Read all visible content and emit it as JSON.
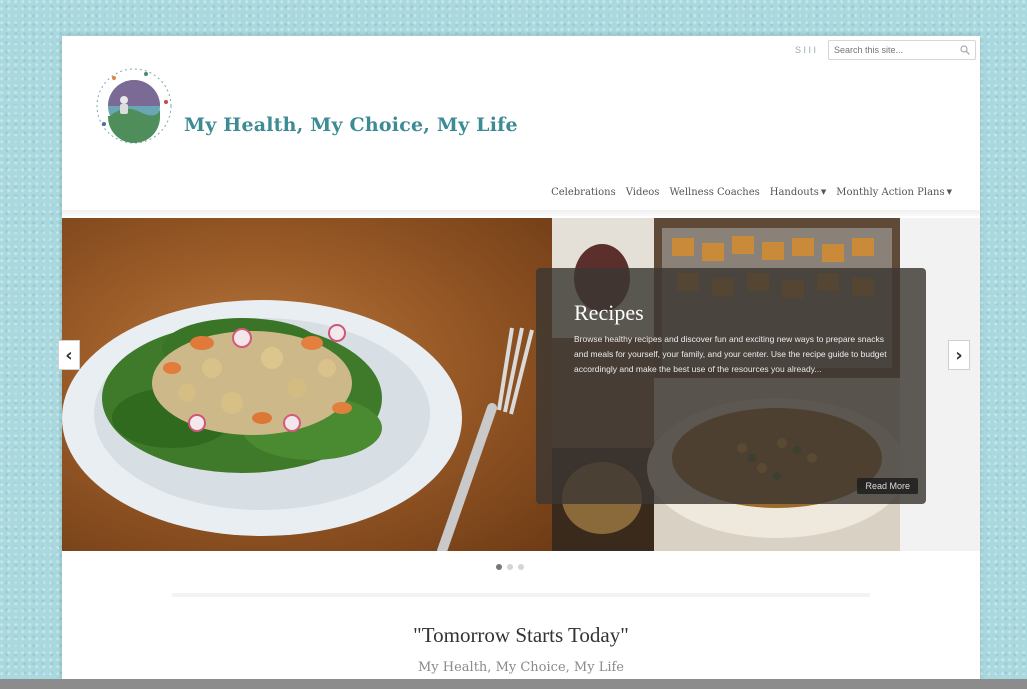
{
  "header": {
    "site_title": "My Health, My Choice, My Life",
    "top_link": "S I I I",
    "search_placeholder": "Search this site..."
  },
  "nav": {
    "items": [
      {
        "label": "Celebrations",
        "has_dropdown": false
      },
      {
        "label": "Videos",
        "has_dropdown": false
      },
      {
        "label": "Wellness Coaches",
        "has_dropdown": false
      },
      {
        "label": "Handouts",
        "has_dropdown": true
      },
      {
        "label": "Monthly Action Plans",
        "has_dropdown": true
      }
    ],
    "dropdown_glyph": "▼"
  },
  "slider": {
    "caption_title": "Recipes",
    "caption_text": "Browse healthy recipes and discover fun and exciting new ways to prepare snacks and meals for yourself, your family, and your center. Use the recipe guide to budget accordingly and make the best use of the resources you already...",
    "read_more": "Read More",
    "prev_glyph": "‹",
    "next_glyph": "›",
    "slide_count": 3,
    "active_slide": 1
  },
  "banner": {
    "quote": "\"Tomorrow Starts Today\"",
    "tagline": "My Health, My Choice, My Life"
  },
  "colors": {
    "background": "#a9d8de",
    "title_teal": "#3d8b94"
  },
  "icons": {
    "search": "search-icon",
    "logo": "logo-emblem"
  }
}
